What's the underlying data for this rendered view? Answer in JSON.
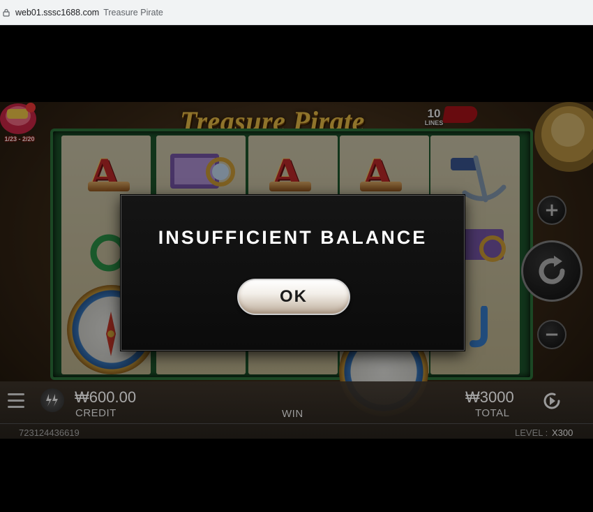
{
  "browser": {
    "url": "web01.sssc1688.com",
    "tab_title": "Treasure Pirate"
  },
  "game": {
    "logo_text": "Treasure Pirate",
    "lines_number": "10",
    "lines_label": "LINES",
    "promo_text": "1/23 - 2/20"
  },
  "hud": {
    "credit_amount": "₩600.00",
    "credit_label": "CREDIT",
    "win_label": "WIN",
    "total_amount": "₩3000",
    "total_label": "TOTAL",
    "account_id": "723124436619",
    "level_label": "LEVEL :",
    "level_value": "X300"
  },
  "modal": {
    "title": "INSUFFICIENT BALANCE",
    "ok_label": "OK"
  },
  "colors": {
    "logo": "#f6c84a",
    "reel_frame": "#1e5a2e",
    "modal_bg": "#0f0f0f"
  }
}
